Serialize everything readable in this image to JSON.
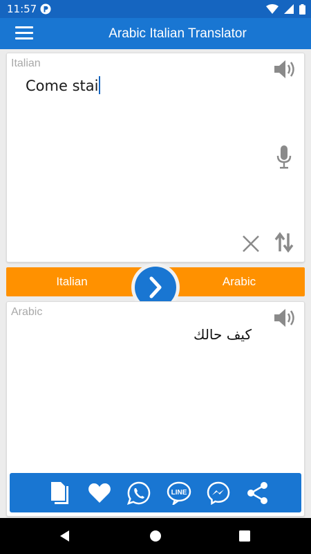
{
  "status_bar": {
    "time": "11:57",
    "icons": [
      "app-notification-icon",
      "wifi-icon",
      "signal-icon",
      "battery-icon"
    ]
  },
  "app_bar": {
    "title": "Arabic Italian Translator",
    "menu_icon": "hamburger-menu-icon"
  },
  "source": {
    "language_label": "Italian",
    "input_value": "Come stai",
    "icons": [
      "speaker-icon",
      "microphone-icon",
      "clear-icon",
      "swap-vertical-icon"
    ]
  },
  "language_bar": {
    "from": "Italian",
    "to": "Arabic",
    "translate_icon": "chevron-right-icon"
  },
  "target": {
    "language_label": "Arabic",
    "output_value": "كيف حالك",
    "icons": [
      "speaker-icon"
    ]
  },
  "share_bar": {
    "icons": [
      "copy-icon",
      "favorite-icon",
      "whatsapp-icon",
      "line-icon",
      "messenger-icon",
      "share-icon"
    ]
  },
  "colors": {
    "primary": "#1976d2",
    "status_bar": "#1565c0",
    "accent": "#ff9100",
    "icon_gray": "#8a8a8a"
  }
}
